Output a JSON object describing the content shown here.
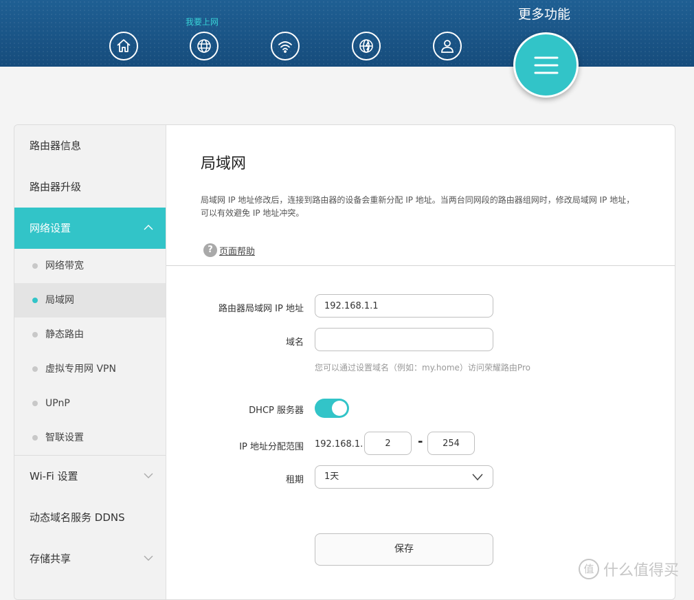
{
  "colors": {
    "accent": "#32c4c8",
    "banner": "#1a5788"
  },
  "top_nav": {
    "items": [
      {
        "icon": "home-icon",
        "label": ""
      },
      {
        "icon": "globe-icon",
        "label": "我要上网"
      },
      {
        "icon": "wifi-icon",
        "label": ""
      },
      {
        "icon": "globe-bolt-icon",
        "label": ""
      },
      {
        "icon": "user-icon",
        "label": ""
      }
    ],
    "more": {
      "label": "更多功能",
      "icon": "menu-icon"
    }
  },
  "sidebar": {
    "items": [
      {
        "label": "路由器信息"
      },
      {
        "label": "路由器升级"
      },
      {
        "label": "网络设置",
        "expanded": true
      }
    ],
    "sub_items": [
      {
        "label": "网络带宽"
      },
      {
        "label": "局域网",
        "active": true
      },
      {
        "label": "静态路由"
      },
      {
        "label": "虚拟专用网 VPN"
      },
      {
        "label": "UPnP"
      },
      {
        "label": "智联设置"
      }
    ],
    "items_after": [
      {
        "label": "Wi-Fi 设置",
        "chevron": "chevron-down-icon"
      },
      {
        "label": "动态域名服务 DDNS"
      },
      {
        "label": "存储共享",
        "chevron": "chevron-down-icon"
      }
    ]
  },
  "content": {
    "title": "局域网",
    "description": "局域网 IP 地址修改后，连接到路由器的设备会重新分配 IP 地址。当两台同网段的路由器组网时，修改局域网 IP 地址，可以有效避免 IP 地址冲突。",
    "help_label": "页面帮助",
    "help_icon": "?",
    "form": {
      "ip_label": "路由器局域网 IP 地址",
      "ip_value": "192.168.1.1",
      "domain_label": "域名",
      "domain_value": "",
      "domain_hint": "您可以通过设置域名（例如：my.home）访问荣耀路由Pro",
      "dhcp_label": "DHCP 服务器",
      "dhcp_enabled": true,
      "range_label": "IP 地址分配范围",
      "range_prefix": "192.168.1.",
      "range_start": "2",
      "range_dash": "-",
      "range_end": "254",
      "lease_label": "租期",
      "lease_value": "1天",
      "save_label": "保存"
    }
  },
  "watermark": {
    "logo": "值",
    "text": "什么值得买"
  }
}
